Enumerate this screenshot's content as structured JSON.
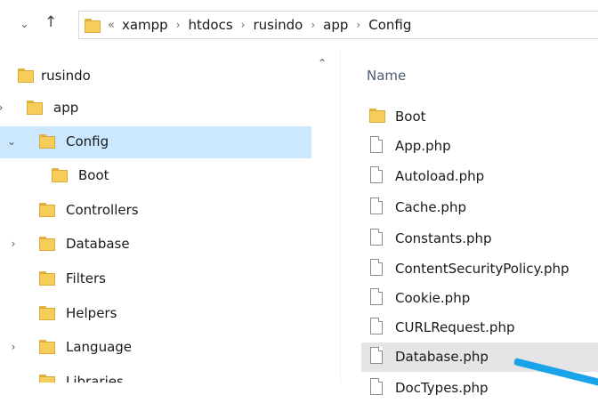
{
  "address_bar": {
    "overflow_glyph": "«",
    "separator": "›",
    "crumbs": [
      "xampp",
      "htdocs",
      "rusindo",
      "app",
      "Config"
    ]
  },
  "nav": {
    "items": [
      {
        "label": "rusindo"
      },
      {
        "label": "app"
      },
      {
        "label": "Config"
      },
      {
        "label": "Boot"
      },
      {
        "label": "Controllers"
      },
      {
        "label": "Database"
      },
      {
        "label": "Filters"
      },
      {
        "label": "Helpers"
      },
      {
        "label": "Language"
      },
      {
        "label": "Libraries"
      }
    ]
  },
  "file_list": {
    "column_header": "Name",
    "items": [
      {
        "name": "Boot",
        "type": "folder"
      },
      {
        "name": "App.php",
        "type": "file"
      },
      {
        "name": "Autoload.php",
        "type": "file"
      },
      {
        "name": "Cache.php",
        "type": "file"
      },
      {
        "name": "Constants.php",
        "type": "file"
      },
      {
        "name": "ContentSecurityPolicy.php",
        "type": "file"
      },
      {
        "name": "Cookie.php",
        "type": "file"
      },
      {
        "name": "CURLRequest.php",
        "type": "file"
      },
      {
        "name": "Database.php",
        "type": "file",
        "hovered": true
      },
      {
        "name": "DocTypes.php",
        "type": "file"
      }
    ]
  },
  "colors": {
    "selection": "#cce8ff",
    "hover": "#e5e5e5",
    "folder": "#f5cd58",
    "annotation_arrow": "#1aa3e8"
  }
}
